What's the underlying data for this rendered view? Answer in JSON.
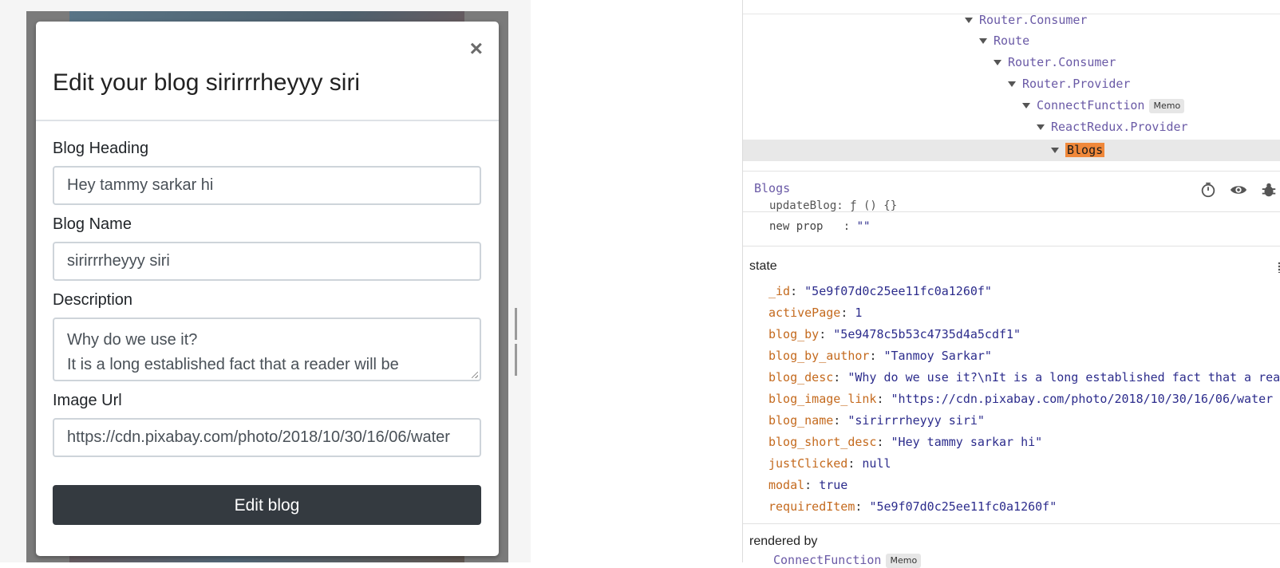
{
  "modal": {
    "title": "Edit your blog sirirrrheyyy siri",
    "close_symbol": "×",
    "fields": {
      "heading_label": "Blog Heading",
      "heading_value": "Hey tammy sarkar hi",
      "name_label": "Blog Name",
      "name_value": "sirirrrheyyy siri",
      "desc_label": "Description",
      "desc_value": "Why do we use it?\nIt is a long established fact that a reader will be",
      "image_label": "Image Url",
      "image_value": "https://cdn.pixabay.com/photo/2018/10/30/16/06/water"
    },
    "submit_label": "Edit blog"
  },
  "devtools": {
    "tree": [
      {
        "name": "Router.Consumer"
      },
      {
        "name": "Route"
      },
      {
        "name": "Router.Consumer"
      },
      {
        "name": "Router.Provider"
      },
      {
        "name": "ConnectFunction",
        "badge": "Memo"
      },
      {
        "name": "ReactRedux.Provider"
      },
      {
        "name": "Blogs",
        "selected": true
      }
    ],
    "selected_component": "Blogs",
    "props_partial": "updateBlog: ƒ () {}",
    "new_prop_key": "new prop",
    "new_prop_value": "\"\"",
    "state_title": "state",
    "state": [
      {
        "key": "_id",
        "value": "\"5e9f07d0c25ee11fc0a1260f\""
      },
      {
        "key": "activePage",
        "value": "1"
      },
      {
        "key": "blog_by",
        "value": "\"5e9478c5b53c4735d4a5cdf1\""
      },
      {
        "key": "blog_by_author",
        "value": "\"Tanmoy Sarkar\""
      },
      {
        "key": "blog_desc",
        "value": "\"Why do we use it?\\nIt is a long established fact that a rea"
      },
      {
        "key": "blog_image_link",
        "value": "\"https://cdn.pixabay.com/photo/2018/10/30/16/06/water"
      },
      {
        "key": "blog_name",
        "value": "\"sirirrrheyyy siri\""
      },
      {
        "key": "blog_short_desc",
        "value": "\"Hey tammy sarkar hi\""
      },
      {
        "key": "justClicked",
        "value": "null"
      },
      {
        "key": "modal",
        "value": "true"
      },
      {
        "key": "requiredItem",
        "value": "\"5e9f07d0c25ee11fc0a1260f\""
      }
    ],
    "rendered_by_title": "rendered by",
    "rendered_by": {
      "name": "ConnectFunction",
      "badge": "Memo"
    },
    "icons": [
      "stopwatch-icon",
      "eye-icon",
      "bug-icon"
    ]
  },
  "colors": {
    "selected_highlight": "#f0883a",
    "component_name": "#6a5aa6",
    "state_key": "#c46a1e",
    "button_dark": "#343a40"
  }
}
